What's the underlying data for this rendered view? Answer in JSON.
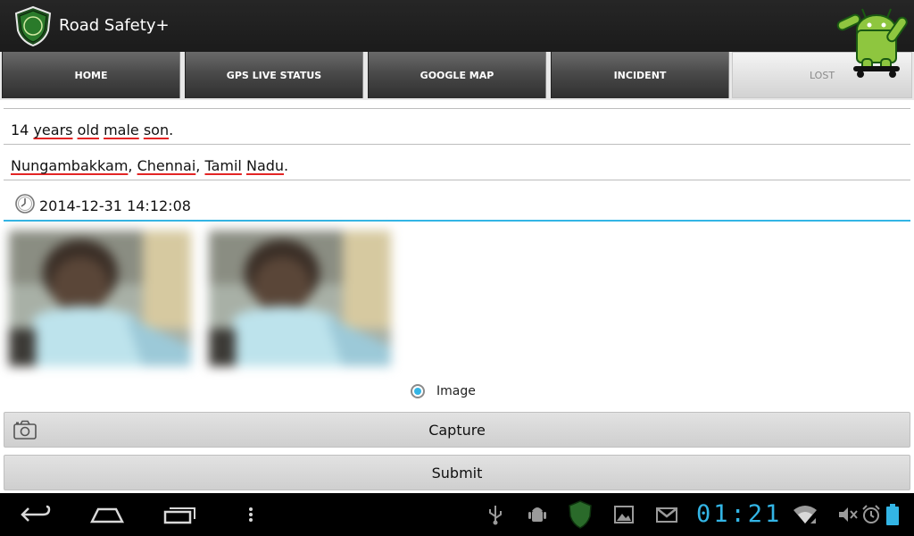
{
  "app": {
    "title": "Road Safety+"
  },
  "tabs": [
    {
      "label": "HOME",
      "active": false
    },
    {
      "label": "GPS LIVE STATUS",
      "active": false
    },
    {
      "label": "GOOGLE MAP",
      "active": false
    },
    {
      "label": "INCIDENT",
      "active": false
    },
    {
      "label": "LOST",
      "active": true
    }
  ],
  "form": {
    "description": "14 years old male son.",
    "location": "Nungambakkam, Chennai, Tamil Nadu.",
    "datetime": "2014-12-31 14:12:08",
    "radio_label": "Image",
    "radio_selected": true,
    "capture_label": "Capture",
    "submit_label": "Submit"
  },
  "system_bar": {
    "time": "01:21",
    "icons": [
      "back-icon",
      "home-icon",
      "recent-apps-icon",
      "menu-icon",
      "usb-icon",
      "android-debug-icon",
      "app-notification-icon",
      "gallery-icon",
      "gmail-icon",
      "wifi-icon",
      "mute-icon",
      "alarm-icon",
      "battery-icon"
    ]
  },
  "colors": {
    "accent": "#33b5e5",
    "spell_error": "#e32525",
    "action_bar": "#1b1b1b",
    "android_green": "#a4c639"
  }
}
